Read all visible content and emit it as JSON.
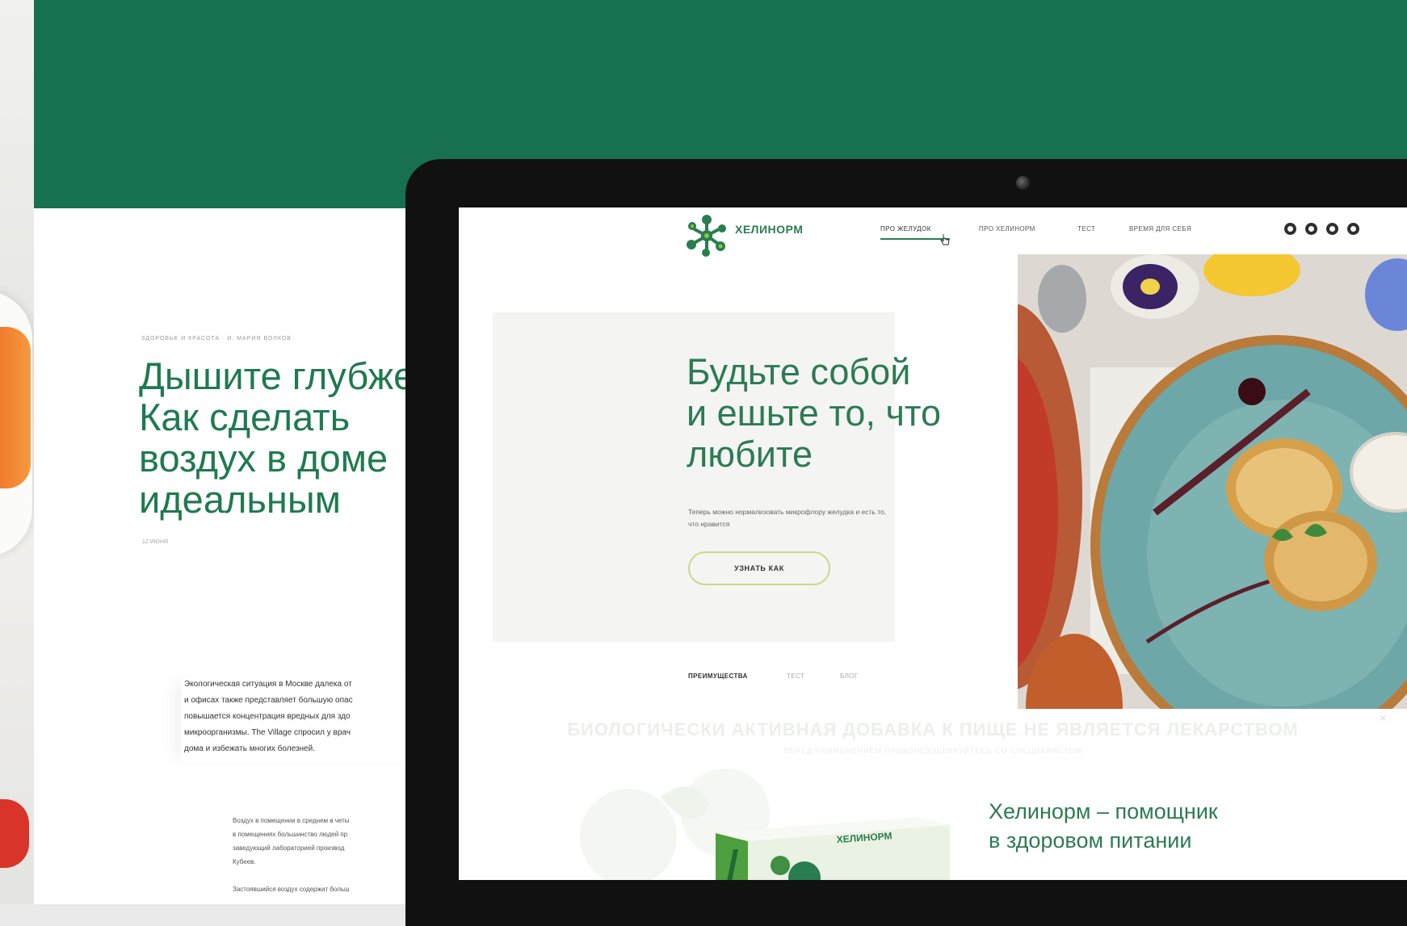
{
  "background_page": {
    "meta": "ЗДОРОВЬЕ И КРАСОТА · И. МАРИЯ ВОЛКОВ",
    "title": "Дышите глубже:\nКак сделать\nвоздух в доме\nидеальным",
    "date": "12 ИЮНЯ",
    "paragraph_1": "Экологическая ситуация в Москве далека от\nи офисах также представляет большую опас\nповышается концентрация вредных для здо\nмикроорганизмы. The Village спросил у врач\nдома и избежать многих болезней.",
    "paragraph_2": "Воздух в помещении в среднем в четы\nв помещениях большинство людей пр\nзаведующий лабораторией производ\nКубеев.\n\nЗастоявшийся воздух содержит больш"
  },
  "site": {
    "logo": "ХЕЛИНОРМ",
    "nav": [
      "ПРО ЖЕЛУДОК",
      "ПРО ХЕЛИНОРМ",
      "ТЕСТ",
      "ВРЕМЯ ДЛЯ СЕБЯ"
    ],
    "social_icons": [
      "instagram-icon",
      "facebook-icon",
      "youtube-icon",
      "vk-icon"
    ],
    "hero": {
      "title": "Будьте собой\nи ешьте то, что\nлюбите",
      "subtitle": "Теперь можно нормализовать микрофлору желудка и есть то, что нравится",
      "button": "УЗНАТЬ КАК"
    },
    "tabs": [
      "ПРЕИМУЩЕСТВА",
      "ТЕСТ",
      "БЛОГ"
    ],
    "disclaimer": "БИОЛОГИЧЕСКИ АКТИВНАЯ ДОБАВКА К ПИЩЕ НЕ ЯВЛЯЕТСЯ ЛЕКАРСТВОМ",
    "disclaimer_small": "ПЕРЕД ПРИМЕНЕНИЕМ ПРОКОНСУЛЬТИРУЙТЕСЬ СО СПЕЦИАЛИСТОМ",
    "close": "×",
    "product_heading": "Хелинорм – помощник\nв здоровом питании",
    "product_box_label": "ХЕЛИНОРМ"
  },
  "colors": {
    "brand_green": "#17714e",
    "text_green": "#2d7b53",
    "button_border": "#c9d98c"
  }
}
